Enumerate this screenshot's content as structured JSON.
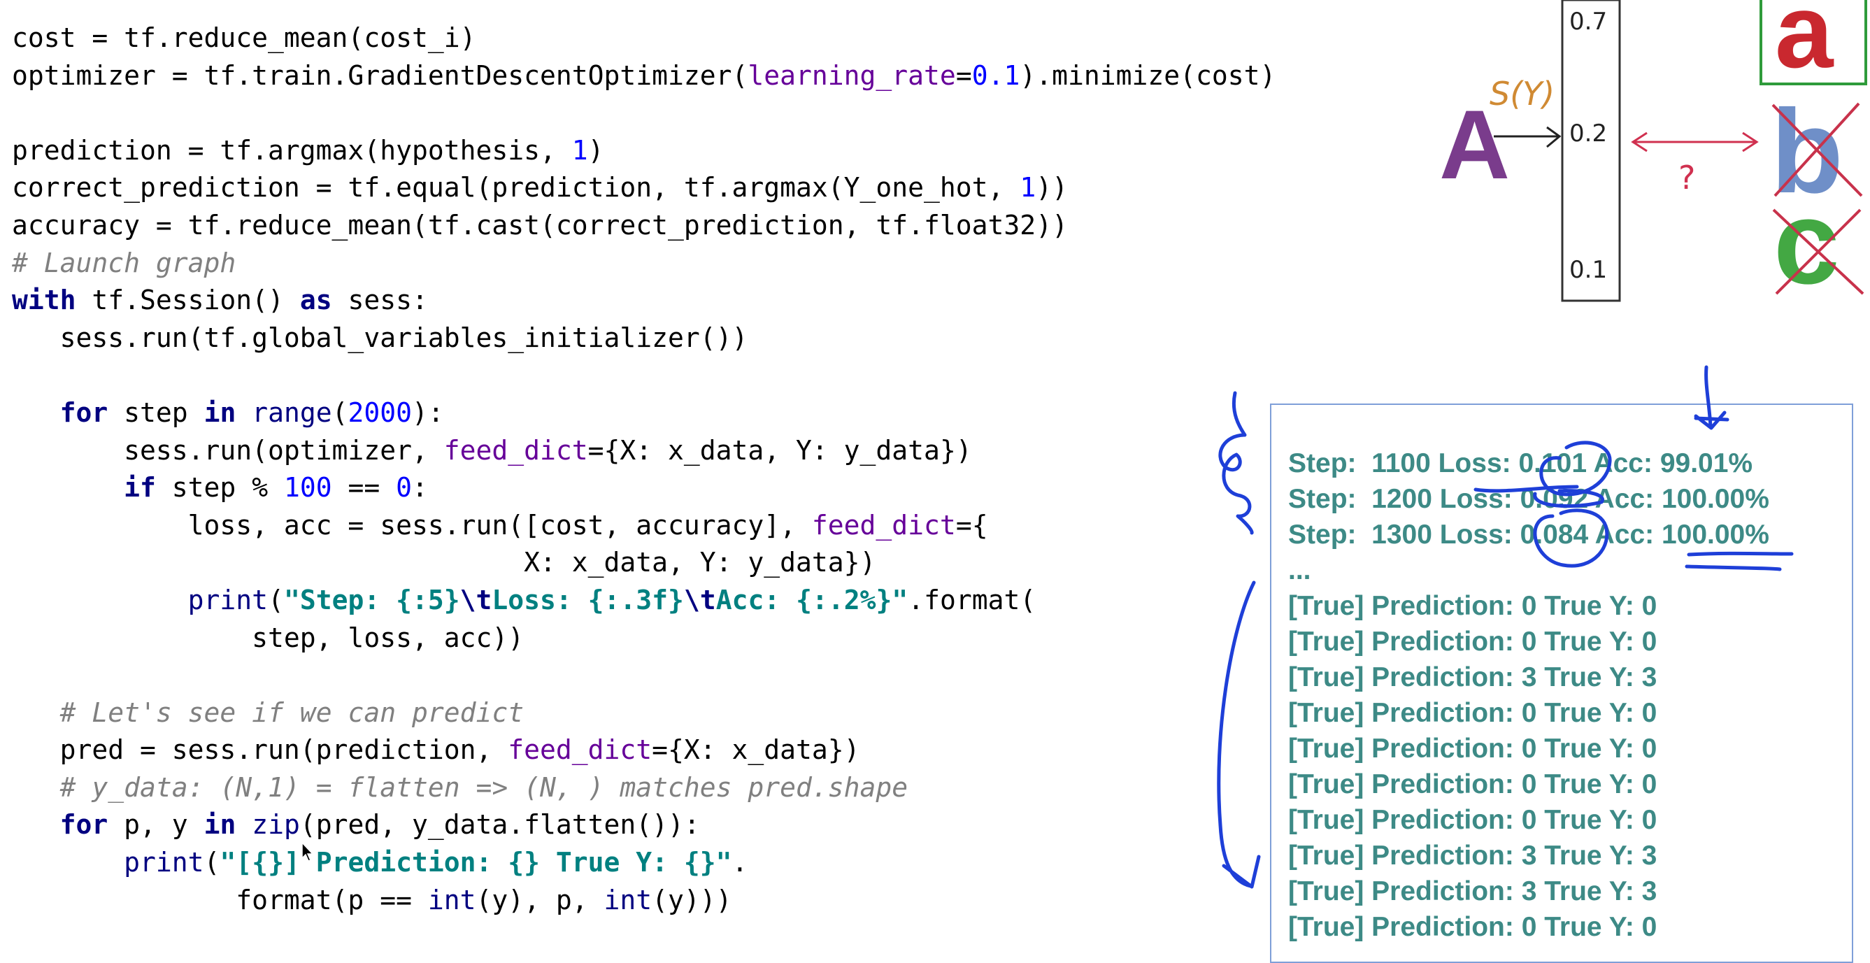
{
  "code": {
    "lines": [
      [
        {
          "t": "cost = tf.reduce_mean(cost_i)",
          "c": ""
        }
      ],
      [
        {
          "t": "optimizer = tf.train.GradientDescentOptimizer(",
          "c": ""
        },
        {
          "t": "learning_rate",
          "c": "param"
        },
        {
          "t": "=",
          "c": ""
        },
        {
          "t": "0.1",
          "c": "num"
        },
        {
          "t": ").minimize(cost)",
          "c": ""
        }
      ],
      [],
      [
        {
          "t": "prediction = tf.argmax(hypothesis, ",
          "c": ""
        },
        {
          "t": "1",
          "c": "num"
        },
        {
          "t": ")",
          "c": ""
        }
      ],
      [
        {
          "t": "correct_prediction = tf.equal(prediction, tf.argmax(Y_one_hot, ",
          "c": ""
        },
        {
          "t": "1",
          "c": "num"
        },
        {
          "t": "))",
          "c": ""
        }
      ],
      [
        {
          "t": "accuracy = tf.reduce_mean(tf.cast(correct_prediction, tf.float32))",
          "c": ""
        }
      ],
      [
        {
          "t": "# Launch graph",
          "c": "cmt"
        }
      ],
      [
        {
          "t": "with",
          "c": "kw"
        },
        {
          "t": " tf.Session() ",
          "c": ""
        },
        {
          "t": "as",
          "c": "kw"
        },
        {
          "t": " sess:",
          "c": ""
        }
      ],
      [
        {
          "t": "   sess.run(tf.global_variables_initializer())",
          "c": ""
        }
      ],
      [],
      [
        {
          "t": "   ",
          "c": ""
        },
        {
          "t": "for",
          "c": "kw"
        },
        {
          "t": " step ",
          "c": ""
        },
        {
          "t": "in",
          "c": "kw"
        },
        {
          "t": " ",
          "c": ""
        },
        {
          "t": "range",
          "c": "fn"
        },
        {
          "t": "(",
          "c": ""
        },
        {
          "t": "2000",
          "c": "num"
        },
        {
          "t": "):",
          "c": ""
        }
      ],
      [
        {
          "t": "       sess.run(optimizer, ",
          "c": ""
        },
        {
          "t": "feed_dict",
          "c": "param"
        },
        {
          "t": "={X: x_data, Y: y_data})",
          "c": ""
        }
      ],
      [
        {
          "t": "       ",
          "c": ""
        },
        {
          "t": "if",
          "c": "kw"
        },
        {
          "t": " step % ",
          "c": ""
        },
        {
          "t": "100",
          "c": "num"
        },
        {
          "t": " == ",
          "c": ""
        },
        {
          "t": "0",
          "c": "num"
        },
        {
          "t": ":",
          "c": ""
        }
      ],
      [
        {
          "t": "           loss, acc = sess.run([cost, accuracy], ",
          "c": ""
        },
        {
          "t": "feed_dict",
          "c": "param"
        },
        {
          "t": "={",
          "c": ""
        }
      ],
      [
        {
          "t": "                                X: x_data, Y: y_data})",
          "c": ""
        }
      ],
      [
        {
          "t": "           ",
          "c": ""
        },
        {
          "t": "print",
          "c": "fn"
        },
        {
          "t": "(",
          "c": ""
        },
        {
          "t": "\"Step: {:5}",
          "c": "str"
        },
        {
          "t": "\\t",
          "c": "esc"
        },
        {
          "t": "Loss: {:.3f}",
          "c": "str"
        },
        {
          "t": "\\t",
          "c": "esc"
        },
        {
          "t": "Acc: {:.2%}\"",
          "c": "str"
        },
        {
          "t": ".format(",
          "c": ""
        }
      ],
      [
        {
          "t": "               step, loss, acc))",
          "c": ""
        }
      ],
      [],
      [
        {
          "t": "   ",
          "c": ""
        },
        {
          "t": "# Let's see if we can predict",
          "c": "cmt"
        }
      ],
      [
        {
          "t": "   pred = sess.run(prediction, ",
          "c": ""
        },
        {
          "t": "feed_dict",
          "c": "param"
        },
        {
          "t": "={X: x_data})",
          "c": ""
        }
      ],
      [
        {
          "t": "   ",
          "c": ""
        },
        {
          "t": "# y_data: (N,1) = flatten => (N, ) matches pred.shape",
          "c": "cmt"
        }
      ],
      [
        {
          "t": "   ",
          "c": ""
        },
        {
          "t": "for",
          "c": "kw"
        },
        {
          "t": " p, y ",
          "c": ""
        },
        {
          "t": "in",
          "c": "kw"
        },
        {
          "t": " ",
          "c": ""
        },
        {
          "t": "zip",
          "c": "fn"
        },
        {
          "t": "(pred, y_data.flatten()):",
          "c": ""
        }
      ],
      [
        {
          "t": "       ",
          "c": ""
        },
        {
          "t": "print",
          "c": "fn"
        },
        {
          "t": "(",
          "c": ""
        },
        {
          "t": "\"[{}] Prediction: {} True Y: {}\"",
          "c": "str"
        },
        {
          "t": ".",
          "c": ""
        }
      ],
      [
        {
          "t": "              format(p == ",
          "c": ""
        },
        {
          "t": "int",
          "c": "fn"
        },
        {
          "t": "(y), p, ",
          "c": ""
        },
        {
          "t": "int",
          "c": "fn"
        },
        {
          "t": "(y)))",
          "c": ""
        }
      ]
    ]
  },
  "illustration": {
    "input_letter": "A",
    "function_label": "S(Y)",
    "probabilities": [
      "0.7",
      "0.2",
      "0.1"
    ],
    "question_mark": "?",
    "targets": [
      "a",
      "b",
      "c"
    ],
    "colors": {
      "letter_a": "#c9282f",
      "letter_A": "#7a3c8c",
      "letter_b": "#6f8fc8",
      "letter_c": "#43a843",
      "cross": "#c8324b",
      "box_green": "#2f9b3b",
      "arrow_label": "#d08a33",
      "double_arrow": "#d0304f"
    }
  },
  "output": {
    "lines": [
      "Step:  1100 Loss: 0.101 Acc: 99.01%",
      "Step:  1200 Loss: 0.092 Acc: 100.00%",
      "Step:  1300 Loss: 0.084 Acc: 100.00%",
      "...",
      "[True] Prediction: 0 True Y: 0",
      "[True] Prediction: 0 True Y: 0",
      "[True] Prediction: 3 True Y: 3",
      "[True] Prediction: 0 True Y: 0",
      "[True] Prediction: 0 True Y: 0",
      "[True] Prediction: 0 True Y: 0",
      "[True] Prediction: 0 True Y: 0",
      "[True] Prediction: 3 True Y: 3",
      "[True] Prediction: 3 True Y: 3",
      "[True] Prediction: 0 True Y: 0"
    ]
  },
  "colors": {
    "output_text": "#3d8a86",
    "output_border": "#7f9fd8",
    "annotation_ink": "#1e3fd8"
  }
}
